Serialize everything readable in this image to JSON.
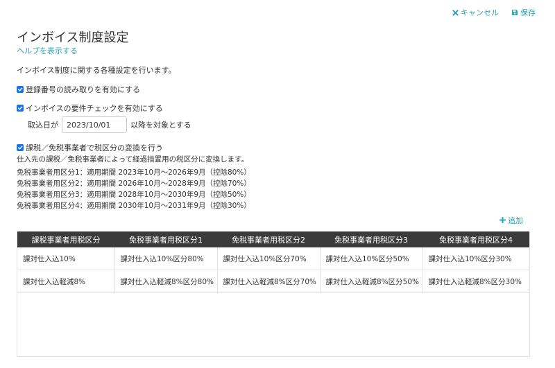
{
  "topbar": {
    "cancel_label": "キャンセル",
    "save_label": "保存"
  },
  "page": {
    "title": "インボイス制度設定",
    "help_link": "ヘルプを表示する",
    "description": "インボイス制度に関する各種設定を行います。"
  },
  "settings": {
    "read_registration": {
      "label": "登録番号の読み取りを有効にする",
      "checked": true
    },
    "requirement_check": {
      "label": "インボイスの要件チェックを有効にする",
      "checked": true
    },
    "date_prefix": "取込日が",
    "date_value": "2023/10/01",
    "date_suffix": "以降を対象とする",
    "convert_tax": {
      "label": "課税／免税事業者で税区分の変換を行う",
      "checked": true
    },
    "convert_note": "仕入先の課税／免税事業者によって経過措置用の税区分に変換します。",
    "periods": [
      "免税事業者用区分1：適用期間 2023年10月〜2026年9月（控除80%）",
      "免税事業者用区分2：適用期間 2026年10月〜2028年9月（控除70%）",
      "免税事業者用区分3：適用期間 2028年10月〜2030年9月（控除50%）",
      "免税事業者用区分4：適用期間 2030年10月〜2031年9月（控除30%）"
    ]
  },
  "table": {
    "add_label": "追加",
    "headers": [
      "課税事業者用税区分",
      "免税事業者用税区分1",
      "免税事業者用税区分2",
      "免税事業者用税区分3",
      "免税事業者用税区分4"
    ],
    "rows": [
      [
        "課対仕入込10%",
        "課対仕入込10%区分80%",
        "課対仕入込10%区分70%",
        "課対仕入込10%区分50%",
        "課対仕入込10%区分30%"
      ],
      [
        "課対仕入込軽減8%",
        "課対仕入込軽減8%区分80%",
        "課対仕入込軽減8%区分70%",
        "課対仕入込軽減8%区分50%",
        "課対仕入込軽減8%区分30%"
      ]
    ]
  },
  "colors": {
    "accent": "#2aa3b3",
    "checkbox": "#1a73e8",
    "table_header": "#3b3b3b"
  }
}
